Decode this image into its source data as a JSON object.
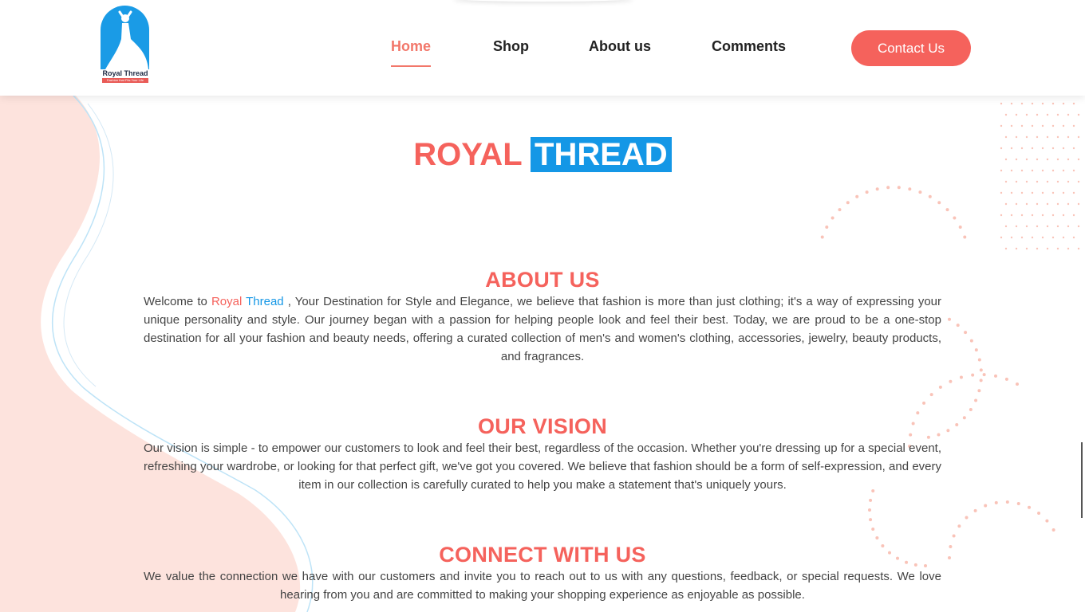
{
  "header": {
    "logo": {
      "name": "Royal Thread",
      "tagline": "Fashion that Fits Your Life"
    },
    "nav": [
      {
        "label": "Home",
        "active": true
      },
      {
        "label": "Shop",
        "active": false
      },
      {
        "label": "About us",
        "active": false
      },
      {
        "label": "Comments",
        "active": false
      }
    ],
    "contact_label": "Contact Us"
  },
  "hero": {
    "word1": "ROYAL",
    "word2": "THREAD"
  },
  "about": {
    "title": "ABOUT US",
    "text_pre": "Welcome to ",
    "brand_part1": "Royal",
    "brand_part2": "Thread",
    "text_post": " , Your Destination for Style and Elegance, we believe that fashion is more than just clothing; it's a way of expressing your unique personality and style. Our journey began with a passion for helping people look and feel their best. Today, we are proud to be a one-stop destination for all your fashion and beauty needs, offering a curated collection of men's and women's clothing, accessories, jewelry, beauty products, and fragrances."
  },
  "vision": {
    "title": "OUR VISION",
    "text": "Our vision is simple - to empower our customers to look and feel their best, regardless of the occasion. Whether you're dressing up for a special event, refreshing your wardrobe, or looking for that perfect gift, we've got you covered. We believe that fashion should be a form of self-expression, and every item in our collection is carefully curated to help you make a statement that's uniquely yours."
  },
  "connect": {
    "title": "CONNECT WITH US",
    "text": "We value the connection we have with our customers and invite you to reach out to us with any questions, feedback, or special requests. We love hearing from you and are committed to making your shopping experience as enjoyable as possible."
  },
  "colors": {
    "accent": "#f5625c",
    "brand_blue": "#1497e6",
    "nav_active": "#f2776a",
    "blob": "#fde3dd"
  }
}
